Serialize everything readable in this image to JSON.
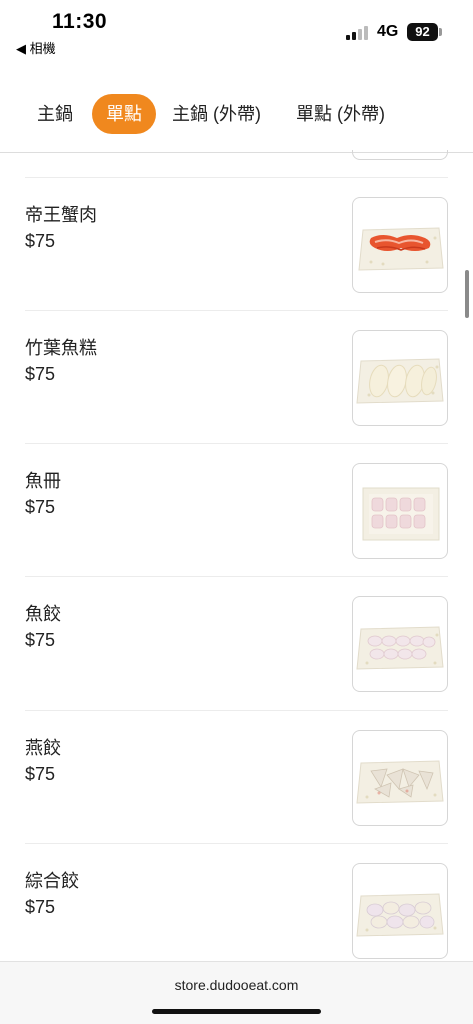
{
  "status_bar": {
    "time": "11:30",
    "back_label": "◀ 相機",
    "network": "4G",
    "battery": "92"
  },
  "tabs": [
    {
      "label": "主鍋",
      "active": false
    },
    {
      "label": "單點",
      "active": true
    },
    {
      "label": "主鍋 (外帶)",
      "active": false
    },
    {
      "label": "單點 (外帶)",
      "active": false
    }
  ],
  "colors": {
    "accent": "#f0881e"
  },
  "items": [
    {
      "name": "帝王蟹肉",
      "price": "$75"
    },
    {
      "name": "竹葉魚糕",
      "price": "$75"
    },
    {
      "name": "魚冊",
      "price": "$75"
    },
    {
      "name": "魚餃",
      "price": "$75"
    },
    {
      "name": "燕餃",
      "price": "$75"
    },
    {
      "name": "綜合餃",
      "price": "$75"
    }
  ],
  "browser": {
    "url": "store.dudooeat.com"
  }
}
